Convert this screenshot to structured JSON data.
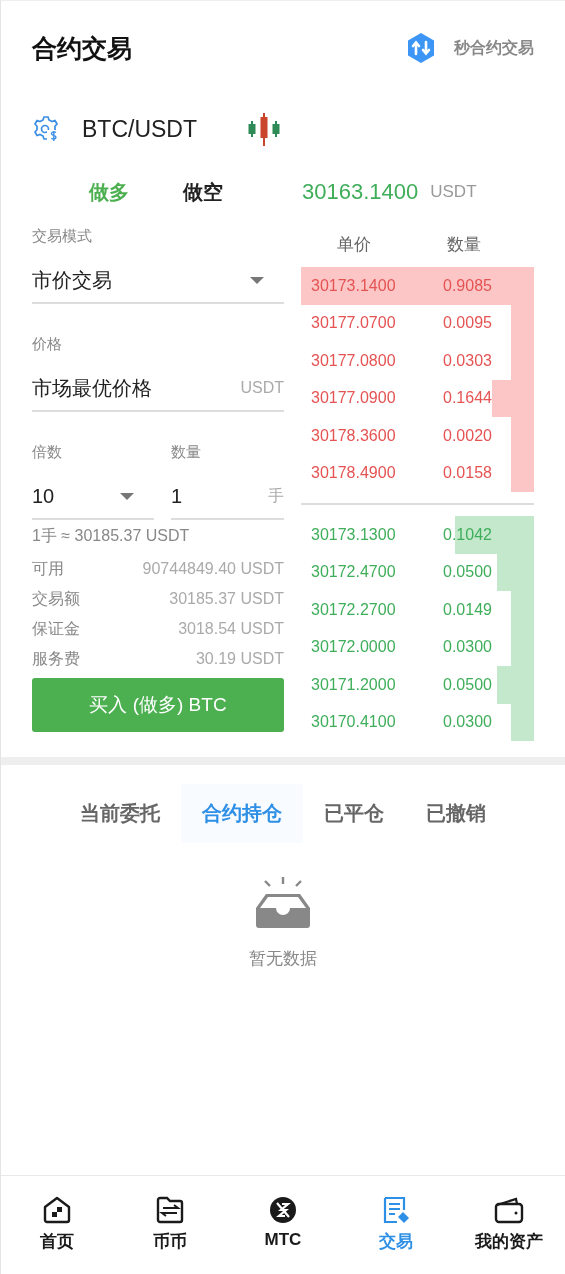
{
  "header": {
    "title": "合约交易",
    "switch_link": "秒合约交易"
  },
  "pair": {
    "symbol": "BTC/USDT"
  },
  "side_tabs": [
    {
      "label": "做多",
      "selected": true
    },
    {
      "label": "做空",
      "selected": false
    }
  ],
  "last_price": {
    "value": "30163.1400",
    "unit": "USDT"
  },
  "form": {
    "mode_label": "交易模式",
    "mode_value": "市价交易",
    "price_label": "价格",
    "price_value": "市场最优价格",
    "price_unit": "USDT",
    "leverage_label": "倍数",
    "leverage_value": "10",
    "quantity_label": "数量",
    "quantity_value": "1",
    "quantity_unit": "手",
    "lot_note": "1手 ≈ 30185.37 USDT",
    "info": [
      {
        "label": "可用",
        "value": "90744849.40 USDT"
      },
      {
        "label": "交易额",
        "value": "30185.37 USDT"
      },
      {
        "label": "保证金",
        "value": "3018.54 USDT"
      },
      {
        "label": "服务费",
        "value": "30.19 USDT"
      }
    ],
    "submit": "买入 (做多) BTC"
  },
  "order_book": {
    "columns": [
      "单价",
      "数量"
    ],
    "asks": [
      {
        "price": "30173.1400",
        "amount": "0.9085"
      },
      {
        "price": "30177.0700",
        "amount": "0.0095"
      },
      {
        "price": "30177.0800",
        "amount": "0.0303"
      },
      {
        "price": "30177.0900",
        "amount": "0.1644"
      },
      {
        "price": "30178.3600",
        "amount": "0.0020"
      },
      {
        "price": "30178.4900",
        "amount": "0.0158"
      }
    ],
    "bids": [
      {
        "price": "30173.1300",
        "amount": "0.1042"
      },
      {
        "price": "30172.4700",
        "amount": "0.0500"
      },
      {
        "price": "30172.2700",
        "amount": "0.0149"
      },
      {
        "price": "30172.0000",
        "amount": "0.0300"
      },
      {
        "price": "30171.2000",
        "amount": "0.0500"
      },
      {
        "price": "30170.4100",
        "amount": "0.0300"
      }
    ]
  },
  "order_tabs": [
    {
      "label": "当前委托",
      "selected": false
    },
    {
      "label": "合约持仓",
      "selected": true
    },
    {
      "label": "已平仓",
      "selected": false
    },
    {
      "label": "已撤销",
      "selected": false
    }
  ],
  "empty_state": {
    "text": "暂无数据"
  },
  "bottom_nav": [
    {
      "label": "首页",
      "selected": false
    },
    {
      "label": "币币",
      "selected": false
    },
    {
      "label": "MTC",
      "selected": false
    },
    {
      "label": "交易",
      "selected": true
    },
    {
      "label": "我的资产",
      "selected": false
    }
  ]
}
